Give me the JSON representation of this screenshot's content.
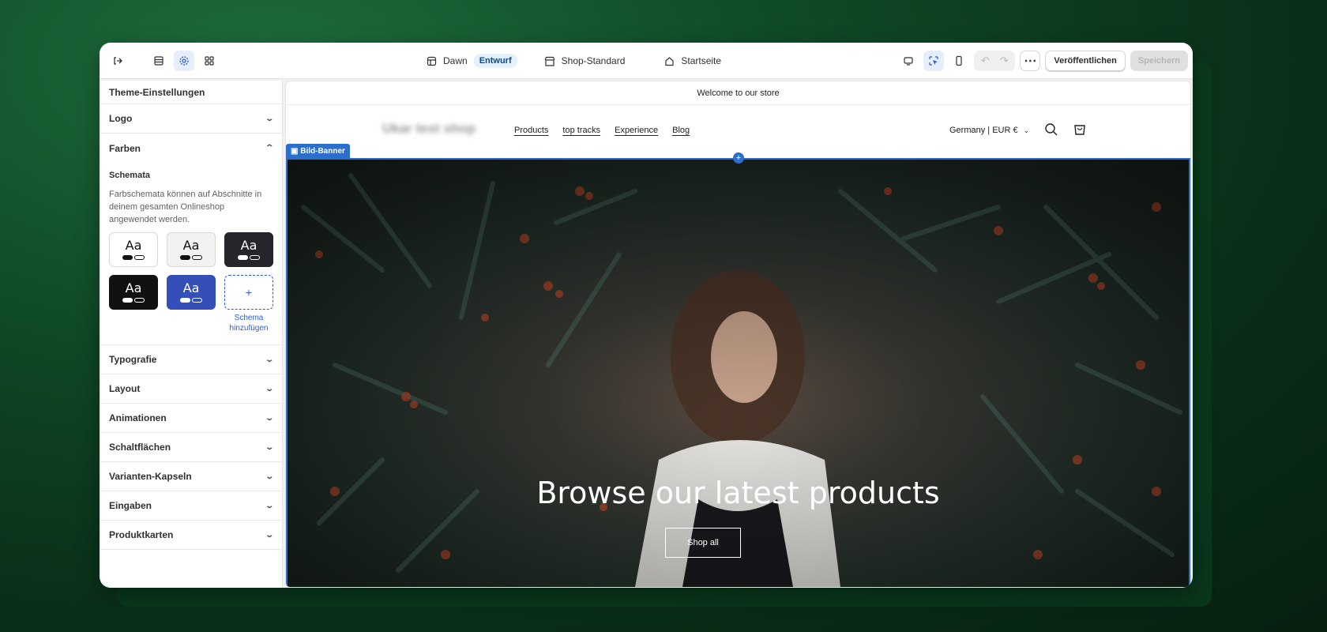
{
  "topbar": {
    "theme_name": "Dawn",
    "theme_badge": "Entwurf",
    "store_preset": "Shop-Standard",
    "page": "Startseite",
    "publish_label": "Veröffentlichen",
    "save_label": "Speichern",
    "icons": [
      "exit-icon",
      "sections-icon",
      "settings-icon",
      "apps-icon",
      "desktop-icon",
      "inspector-icon",
      "mobile-icon",
      "undo-icon",
      "redo-icon",
      "more-icon"
    ]
  },
  "sidebar": {
    "title": "Theme-Einstellungen",
    "logo_label": "Logo",
    "farben_label": "Farben",
    "schemata_title": "Schemata",
    "schemata_desc": "Farbschemata können auf Abschnitte in deinem gesamten Onlineshop angewendet werden.",
    "swatches": [
      {
        "label": "Aa",
        "bg": "#ffffff",
        "fg": "#111111",
        "pill1": "#111111",
        "pill2": "#ffffff"
      },
      {
        "label": "Aa",
        "bg": "#f2f2f2",
        "fg": "#111111",
        "pill1": "#111111",
        "pill2": "#f2f2f2"
      },
      {
        "label": "Aa",
        "bg": "#24262b",
        "fg": "#ffffff",
        "pill1": "#ffffff",
        "pill2": "#24262b"
      },
      {
        "label": "Aa",
        "bg": "#111111",
        "fg": "#ffffff",
        "pill1": "#ffffff",
        "pill2": "#111111"
      },
      {
        "label": "Aa",
        "bg": "#3450b8",
        "fg": "#ffffff",
        "pill1": "#ffffff",
        "pill2": "#3450b8"
      }
    ],
    "add_schema_symbol": "+",
    "add_schema_label": "Schema hinzufügen",
    "sections": [
      "Typografie",
      "Layout",
      "Animationen",
      "Schaltflächen",
      "Varianten-Kapseln",
      "Eingaben",
      "Produktkarten"
    ]
  },
  "preview": {
    "announcement": "Welcome to our store",
    "shop_name": "Ukar test shop",
    "nav": [
      "Products",
      "top tracks",
      "Experience",
      "Blog"
    ],
    "locale": "Germany | EUR €",
    "section_tag": "Bild-Banner",
    "banner_title": "Browse our latest products",
    "banner_button": "Shop all"
  }
}
